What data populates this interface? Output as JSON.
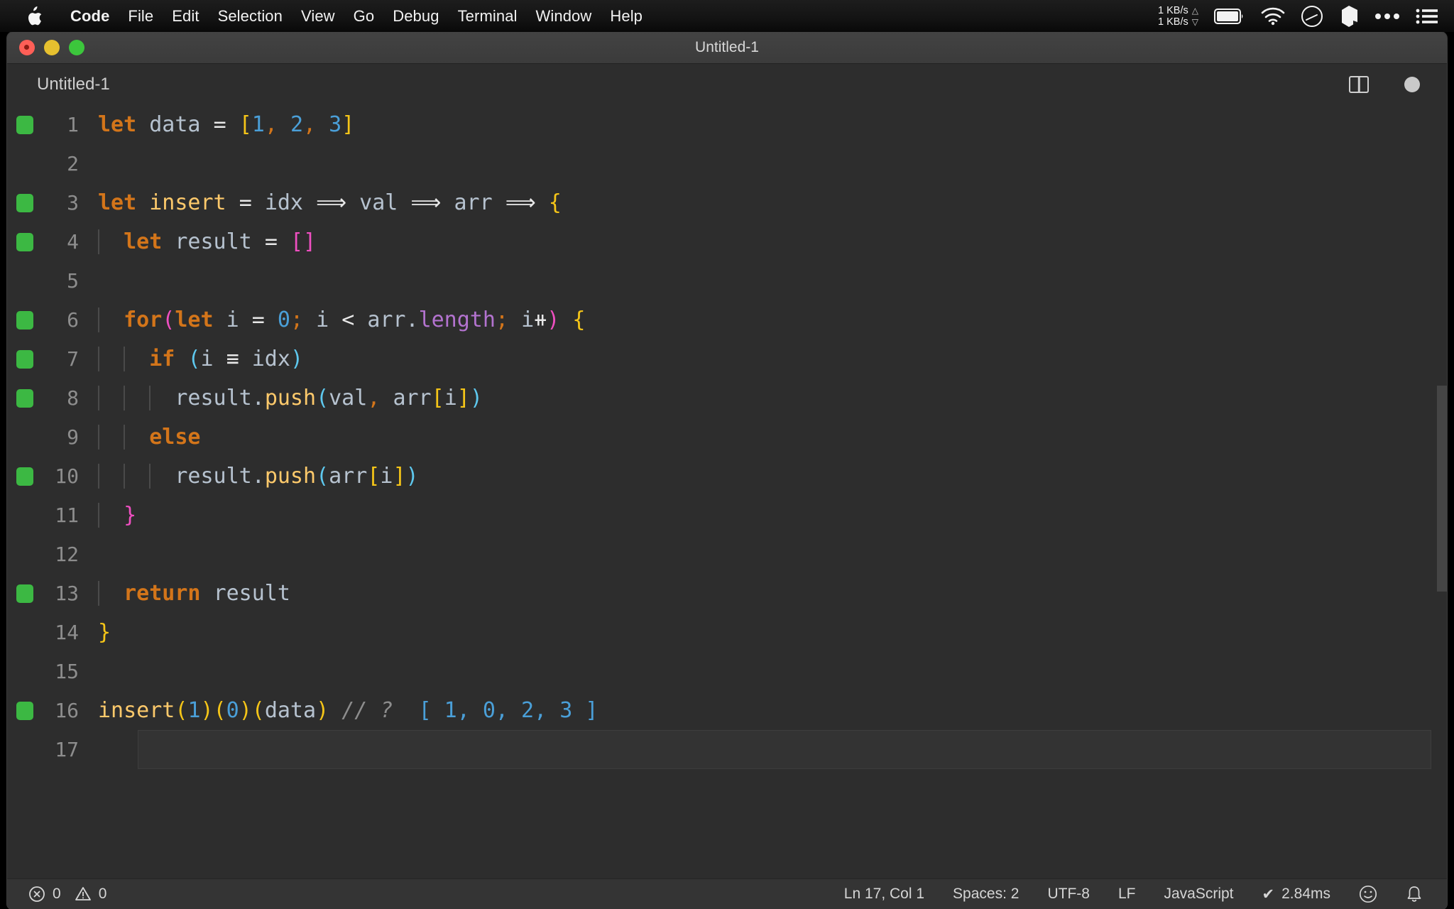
{
  "menubar": {
    "apple_icon": "apple-logo-icon",
    "items": [
      "Code",
      "File",
      "Edit",
      "Selection",
      "View",
      "Go",
      "Debug",
      "Terminal",
      "Window",
      "Help"
    ],
    "status": {
      "net_up": "1 KB/s",
      "net_down": "1 KB/s",
      "up_arrow": "△",
      "down_arrow": "▽",
      "icons": [
        "battery-icon",
        "wifi-icon",
        "gauge-icon",
        "dropbox-icon",
        "ellipsis-icon",
        "list-icon"
      ]
    }
  },
  "window": {
    "title": "Untitled-1",
    "controls": [
      "close-button",
      "minimize-button",
      "zoom-button"
    ]
  },
  "tabbar": {
    "active_tab": "Untitled-1",
    "split_editor_icon": "split-editor-icon",
    "unsaved_indicator": "unsaved-dot-icon"
  },
  "editor": {
    "language": "JavaScript",
    "lines": [
      {
        "n": "1",
        "mark": true,
        "indent": 0,
        "tokens": [
          {
            "t": "let",
            "c": "t-kw"
          },
          {
            "t": " ",
            "c": "t-var"
          },
          {
            "t": "data",
            "c": "t-var"
          },
          {
            "t": " ",
            "c": "t-var"
          },
          {
            "t": "=",
            "c": "t-op"
          },
          {
            "t": " ",
            "c": "t-var"
          },
          {
            "t": "[",
            "c": "t-yel"
          },
          {
            "t": "1",
            "c": "t-num"
          },
          {
            "t": ",",
            "c": "t-punc"
          },
          {
            "t": " ",
            "c": "t-var"
          },
          {
            "t": "2",
            "c": "t-num"
          },
          {
            "t": ",",
            "c": "t-punc"
          },
          {
            "t": " ",
            "c": "t-var"
          },
          {
            "t": "3",
            "c": "t-num"
          },
          {
            "t": "]",
            "c": "t-yel"
          }
        ]
      },
      {
        "n": "2",
        "mark": false,
        "indent": 0,
        "tokens": []
      },
      {
        "n": "3",
        "mark": true,
        "indent": 0,
        "tokens": [
          {
            "t": "let",
            "c": "t-kw"
          },
          {
            "t": " ",
            "c": "t-var"
          },
          {
            "t": "insert",
            "c": "t-fn"
          },
          {
            "t": " ",
            "c": "t-var"
          },
          {
            "t": "=",
            "c": "t-op"
          },
          {
            "t": " ",
            "c": "t-var"
          },
          {
            "t": "idx",
            "c": "t-var"
          },
          {
            "t": " ",
            "c": "t-var"
          },
          {
            "t": "⟹",
            "c": "t-op"
          },
          {
            "t": " ",
            "c": "t-var"
          },
          {
            "t": "val",
            "c": "t-var"
          },
          {
            "t": " ",
            "c": "t-var"
          },
          {
            "t": "⟹",
            "c": "t-op"
          },
          {
            "t": " ",
            "c": "t-var"
          },
          {
            "t": "arr",
            "c": "t-var"
          },
          {
            "t": " ",
            "c": "t-var"
          },
          {
            "t": "⟹",
            "c": "t-op"
          },
          {
            "t": " ",
            "c": "t-var"
          },
          {
            "t": "{",
            "c": "t-yel"
          }
        ]
      },
      {
        "n": "4",
        "mark": true,
        "indent": 1,
        "tokens": [
          {
            "t": "  ",
            "c": "t-var"
          },
          {
            "t": "let",
            "c": "t-kw"
          },
          {
            "t": " ",
            "c": "t-var"
          },
          {
            "t": "result",
            "c": "t-var"
          },
          {
            "t": " ",
            "c": "t-var"
          },
          {
            "t": "=",
            "c": "t-op"
          },
          {
            "t": " ",
            "c": "t-var"
          },
          {
            "t": "[]",
            "c": "t-mag"
          }
        ]
      },
      {
        "n": "5",
        "mark": false,
        "indent": 1,
        "tokens": []
      },
      {
        "n": "6",
        "mark": true,
        "indent": 1,
        "tokens": [
          {
            "t": "  ",
            "c": "t-var"
          },
          {
            "t": "for",
            "c": "t-kw"
          },
          {
            "t": "(",
            "c": "t-mag"
          },
          {
            "t": "let",
            "c": "t-kw"
          },
          {
            "t": " ",
            "c": "t-var"
          },
          {
            "t": "i",
            "c": "t-var"
          },
          {
            "t": " ",
            "c": "t-var"
          },
          {
            "t": "=",
            "c": "t-op"
          },
          {
            "t": " ",
            "c": "t-var"
          },
          {
            "t": "0",
            "c": "t-num"
          },
          {
            "t": ";",
            "c": "t-punc"
          },
          {
            "t": " ",
            "c": "t-var"
          },
          {
            "t": "i",
            "c": "t-var"
          },
          {
            "t": " ",
            "c": "t-var"
          },
          {
            "t": "<",
            "c": "t-op"
          },
          {
            "t": " ",
            "c": "t-var"
          },
          {
            "t": "arr",
            "c": "t-var"
          },
          {
            "t": ".",
            "c": "t-var"
          },
          {
            "t": "length",
            "c": "t-prop"
          },
          {
            "t": ";",
            "c": "t-punc"
          },
          {
            "t": " ",
            "c": "t-var"
          },
          {
            "t": "i",
            "c": "t-var"
          },
          {
            "t": "⧺",
            "c": "t-op"
          },
          {
            "t": ")",
            "c": "t-mag"
          },
          {
            "t": " ",
            "c": "t-var"
          },
          {
            "t": "{",
            "c": "t-yel"
          }
        ]
      },
      {
        "n": "7",
        "mark": true,
        "indent": 2,
        "tokens": [
          {
            "t": "    ",
            "c": "t-var"
          },
          {
            "t": "if",
            "c": "t-kw"
          },
          {
            "t": " ",
            "c": "t-var"
          },
          {
            "t": "(",
            "c": "t-cyan"
          },
          {
            "t": "i",
            "c": "t-var"
          },
          {
            "t": " ",
            "c": "t-var"
          },
          {
            "t": "≡",
            "c": "t-op"
          },
          {
            "t": " ",
            "c": "t-var"
          },
          {
            "t": "idx",
            "c": "t-var"
          },
          {
            "t": ")",
            "c": "t-cyan"
          }
        ]
      },
      {
        "n": "8",
        "mark": true,
        "indent": 3,
        "tokens": [
          {
            "t": "      ",
            "c": "t-var"
          },
          {
            "t": "result",
            "c": "t-var"
          },
          {
            "t": ".",
            "c": "t-var"
          },
          {
            "t": "push",
            "c": "t-fn"
          },
          {
            "t": "(",
            "c": "t-cyan"
          },
          {
            "t": "val",
            "c": "t-var"
          },
          {
            "t": ",",
            "c": "t-punc"
          },
          {
            "t": " ",
            "c": "t-var"
          },
          {
            "t": "arr",
            "c": "t-var"
          },
          {
            "t": "[",
            "c": "t-yel"
          },
          {
            "t": "i",
            "c": "t-var"
          },
          {
            "t": "]",
            "c": "t-yel"
          },
          {
            "t": ")",
            "c": "t-cyan"
          }
        ]
      },
      {
        "n": "9",
        "mark": false,
        "indent": 2,
        "tokens": [
          {
            "t": "    ",
            "c": "t-var"
          },
          {
            "t": "else",
            "c": "t-kw"
          }
        ]
      },
      {
        "n": "10",
        "mark": true,
        "indent": 3,
        "tokens": [
          {
            "t": "      ",
            "c": "t-var"
          },
          {
            "t": "result",
            "c": "t-var"
          },
          {
            "t": ".",
            "c": "t-var"
          },
          {
            "t": "push",
            "c": "t-fn"
          },
          {
            "t": "(",
            "c": "t-cyan"
          },
          {
            "t": "arr",
            "c": "t-var"
          },
          {
            "t": "[",
            "c": "t-yel"
          },
          {
            "t": "i",
            "c": "t-var"
          },
          {
            "t": "]",
            "c": "t-yel"
          },
          {
            "t": ")",
            "c": "t-cyan"
          }
        ]
      },
      {
        "n": "11",
        "mark": false,
        "indent": 1,
        "tokens": [
          {
            "t": "  ",
            "c": "t-var"
          },
          {
            "t": "}",
            "c": "t-mag"
          }
        ]
      },
      {
        "n": "12",
        "mark": false,
        "indent": 1,
        "tokens": []
      },
      {
        "n": "13",
        "mark": true,
        "indent": 1,
        "tokens": [
          {
            "t": "  ",
            "c": "t-var"
          },
          {
            "t": "return",
            "c": "t-kw"
          },
          {
            "t": " ",
            "c": "t-var"
          },
          {
            "t": "result",
            "c": "t-var"
          }
        ]
      },
      {
        "n": "14",
        "mark": false,
        "indent": 0,
        "tokens": [
          {
            "t": "}",
            "c": "t-yel"
          }
        ]
      },
      {
        "n": "15",
        "mark": false,
        "indent": 0,
        "tokens": []
      },
      {
        "n": "16",
        "mark": true,
        "indent": 0,
        "tokens": [
          {
            "t": "insert",
            "c": "t-fn"
          },
          {
            "t": "(",
            "c": "t-yel"
          },
          {
            "t": "1",
            "c": "t-num"
          },
          {
            "t": ")",
            "c": "t-yel"
          },
          {
            "t": "(",
            "c": "t-yel"
          },
          {
            "t": "0",
            "c": "t-num"
          },
          {
            "t": ")",
            "c": "t-yel"
          },
          {
            "t": "(",
            "c": "t-yel"
          },
          {
            "t": "data",
            "c": "t-var"
          },
          {
            "t": ")",
            "c": "t-yel"
          },
          {
            "t": " ",
            "c": "t-var"
          },
          {
            "t": "// ?",
            "c": "t-cmt"
          },
          {
            "t": "  ",
            "c": "t-var"
          },
          {
            "t": "[ 1, 0, 2, 3 ]",
            "c": "t-cmtb"
          }
        ]
      },
      {
        "n": "17",
        "mark": false,
        "indent": 0,
        "tokens": []
      }
    ]
  },
  "statusbar": {
    "errors": "0",
    "warnings": "0",
    "error_icon": "error-circle-icon",
    "warning_icon": "warning-triangle-icon",
    "cursor_position": "Ln 17, Col 1",
    "indentation": "Spaces: 2",
    "encoding": "UTF-8",
    "eol": "LF",
    "language": "JavaScript",
    "quokka_status": "2.84ms",
    "quokka_check": "✔",
    "feedback_icon": "smiley-icon",
    "notifications_icon": "bell-icon"
  }
}
